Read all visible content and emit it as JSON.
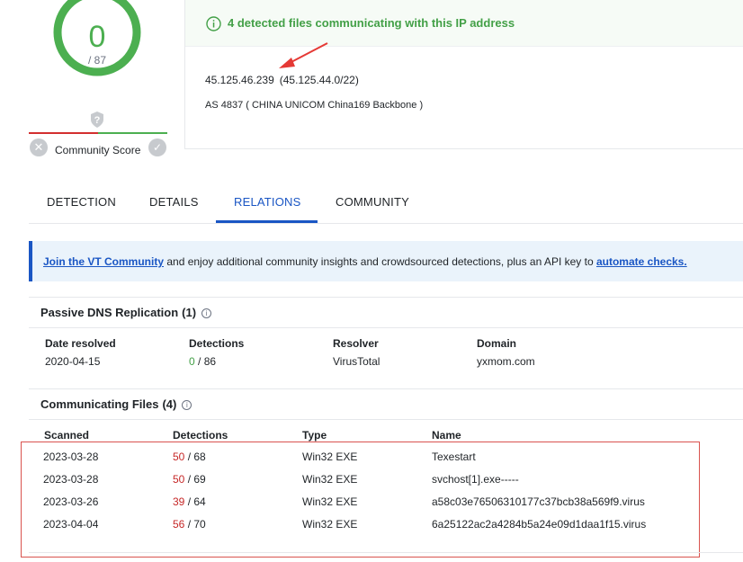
{
  "score": {
    "detections": "0",
    "total": "/ 87",
    "community_label": "Community Score",
    "question_icon": "question-mark-icon",
    "vote_no_icon": "close-icon",
    "vote_yes_icon": "check-icon"
  },
  "summary": {
    "banner": "4 detected files communicating with this IP address",
    "ip": "45.125.46.239",
    "ip_range": "(45.125.44.0/22)",
    "as_info": "AS 4837 ( CHINA UNICOM China169 Backbone )"
  },
  "tabs": [
    {
      "label": "DETECTION"
    },
    {
      "label": "DETAILS"
    },
    {
      "label": "RELATIONS"
    },
    {
      "label": "COMMUNITY"
    }
  ],
  "vt_banner": {
    "link": "Join the VT Community",
    "text": " and enjoy additional community insights and crowdsourced detections, plus an API key to ",
    "link2": "automate checks."
  },
  "dns": {
    "title": "Passive DNS Replication",
    "count": "(1)",
    "headers": [
      "Date resolved",
      "Detections",
      "Resolver",
      "Domain"
    ],
    "rows": [
      {
        "date": "2020-04-15",
        "det": "0",
        "det_total": " / 86",
        "resolver": "VirusTotal",
        "domain": "yxmom.com"
      }
    ]
  },
  "files": {
    "title": "Communicating Files",
    "count": "(4)",
    "headers": [
      "Scanned",
      "Detections",
      "Type",
      "Name"
    ],
    "rows": [
      {
        "scanned": "2023-03-28",
        "det": "50",
        "det_total": " / 68",
        "type": "Win32 EXE",
        "name": "Texestart"
      },
      {
        "scanned": "2023-03-28",
        "det": "50",
        "det_total": " / 69",
        "type": "Win32 EXE",
        "name": "svchost[1].exe-----"
      },
      {
        "scanned": "2023-03-26",
        "det": "39",
        "det_total": " / 64",
        "type": "Win32 EXE",
        "name": "a58c03e76506310177c37bcb38a569f9.virus"
      },
      {
        "scanned": "2023-04-04",
        "det": "56",
        "det_total": " / 70",
        "type": "Win32 EXE",
        "name": "6a25122ac2a4284b5a24e09d1daa1f15.virus"
      }
    ]
  },
  "colors": {
    "accent": "#1a56c4",
    "clean": "#43a047",
    "malicious": "#c62828",
    "annotation": "#e53935"
  }
}
